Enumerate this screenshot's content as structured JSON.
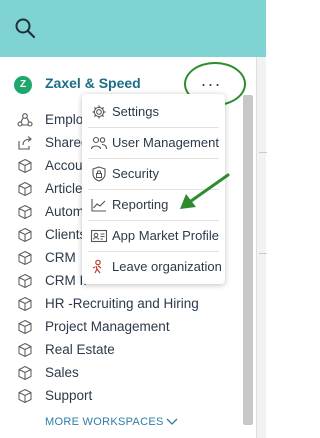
{
  "workspace": {
    "badge": "Z",
    "name": "Zaxel & Speed",
    "more": "···"
  },
  "workspaces": [
    {
      "label": "Employee",
      "icon": "people-icon"
    },
    {
      "label": "Shared",
      "icon": "share-icon"
    },
    {
      "label": "Accounting",
      "icon": "cube-icon"
    },
    {
      "label": "Articles",
      "icon": "cube-icon"
    },
    {
      "label": "Automation",
      "icon": "cube-icon"
    },
    {
      "label": "Clients",
      "icon": "cube-icon"
    },
    {
      "label": "CRM",
      "icon": "cube-icon"
    },
    {
      "label": "CRM II",
      "icon": "cube-icon"
    },
    {
      "label": "HR -Recruiting and Hiring",
      "icon": "cube-icon"
    },
    {
      "label": "Project Management",
      "icon": "cube-icon"
    },
    {
      "label": "Real Estate",
      "icon": "cube-icon"
    },
    {
      "label": "Sales",
      "icon": "cube-icon"
    },
    {
      "label": "Support",
      "icon": "cube-icon"
    }
  ],
  "more_workspaces": "MORE WORKSPACES",
  "menu": [
    {
      "label": "Settings",
      "icon": "gear-icon"
    },
    {
      "label": "User Management",
      "icon": "users-icon"
    },
    {
      "label": "Security",
      "icon": "lock-icon"
    },
    {
      "label": "Reporting",
      "icon": "chart-icon"
    },
    {
      "label": "App Market Profile",
      "icon": "profile-card-icon"
    },
    {
      "label": "Leave organization",
      "icon": "leave-icon"
    }
  ],
  "colors": {
    "topbar": "#7fd3d3",
    "accent": "#1a6e87",
    "annotation": "#2e8b2e",
    "leave": "#c0392b"
  }
}
